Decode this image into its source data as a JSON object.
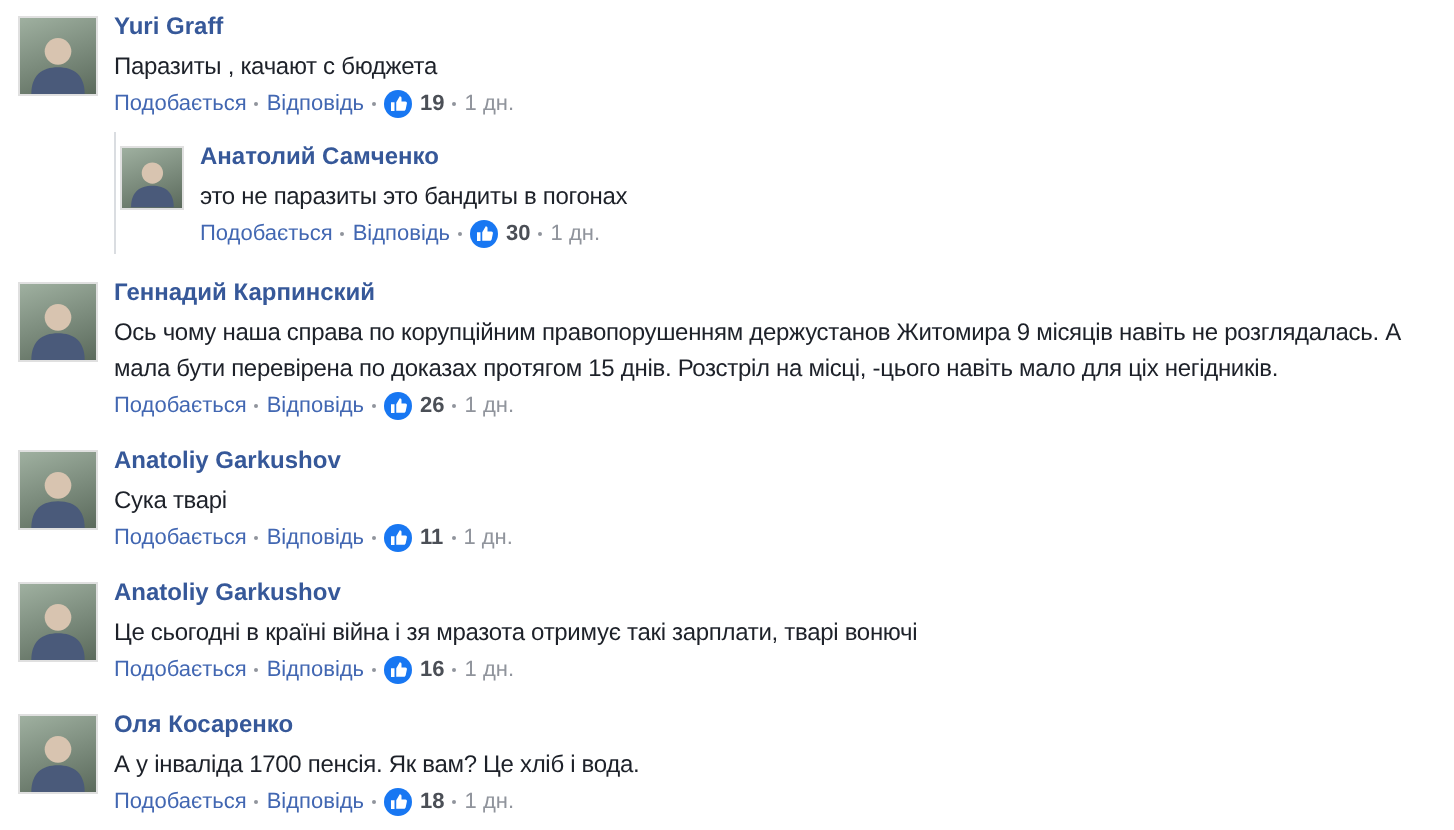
{
  "comments": [
    {
      "author": "Yuri Graff",
      "text": "Паразиты , качают с бюджета",
      "like_label": "Подобається",
      "reply_label": "Відповідь",
      "likes": "19",
      "time": "1 дн.",
      "children": [
        {
          "author": "Анатолий Самченко",
          "text": "это не паразиты это бандиты в погонах",
          "like_label": "Подобається",
          "reply_label": "Відповідь",
          "likes": "30",
          "time": "1 дн."
        }
      ]
    },
    {
      "author": "Геннадий Карпинский",
      "text": "Ось чому наша справа по корупційним правопорушенням держустанов Житомира 9 місяців навіть не розглядалась. А мала бути перевірена по доказах протягом 15 днів. Розстріл на місці, -цього навіть мало для ціх негідників.",
      "like_label": "Подобається",
      "reply_label": "Відповідь",
      "likes": "26",
      "time": "1 дн."
    },
    {
      "author": "Anatoliy Garkushov",
      "text": "Сука тварі",
      "like_label": "Подобається",
      "reply_label": "Відповідь",
      "likes": "11",
      "time": "1 дн."
    },
    {
      "author": "Anatoliy Garkushov",
      "text": "Це сьогодні в країні війна і зя мразота отримує такі зарплати, тварі вонючі",
      "like_label": "Подобається",
      "reply_label": "Відповідь",
      "likes": "16",
      "time": "1 дн."
    },
    {
      "author": "Оля Косаренко",
      "text": "А у інваліда 1700 пенсія. Як вам? Це хліб і вода.",
      "like_label": "Подобається",
      "reply_label": "Відповідь",
      "likes": "18",
      "time": "1 дн."
    }
  ]
}
